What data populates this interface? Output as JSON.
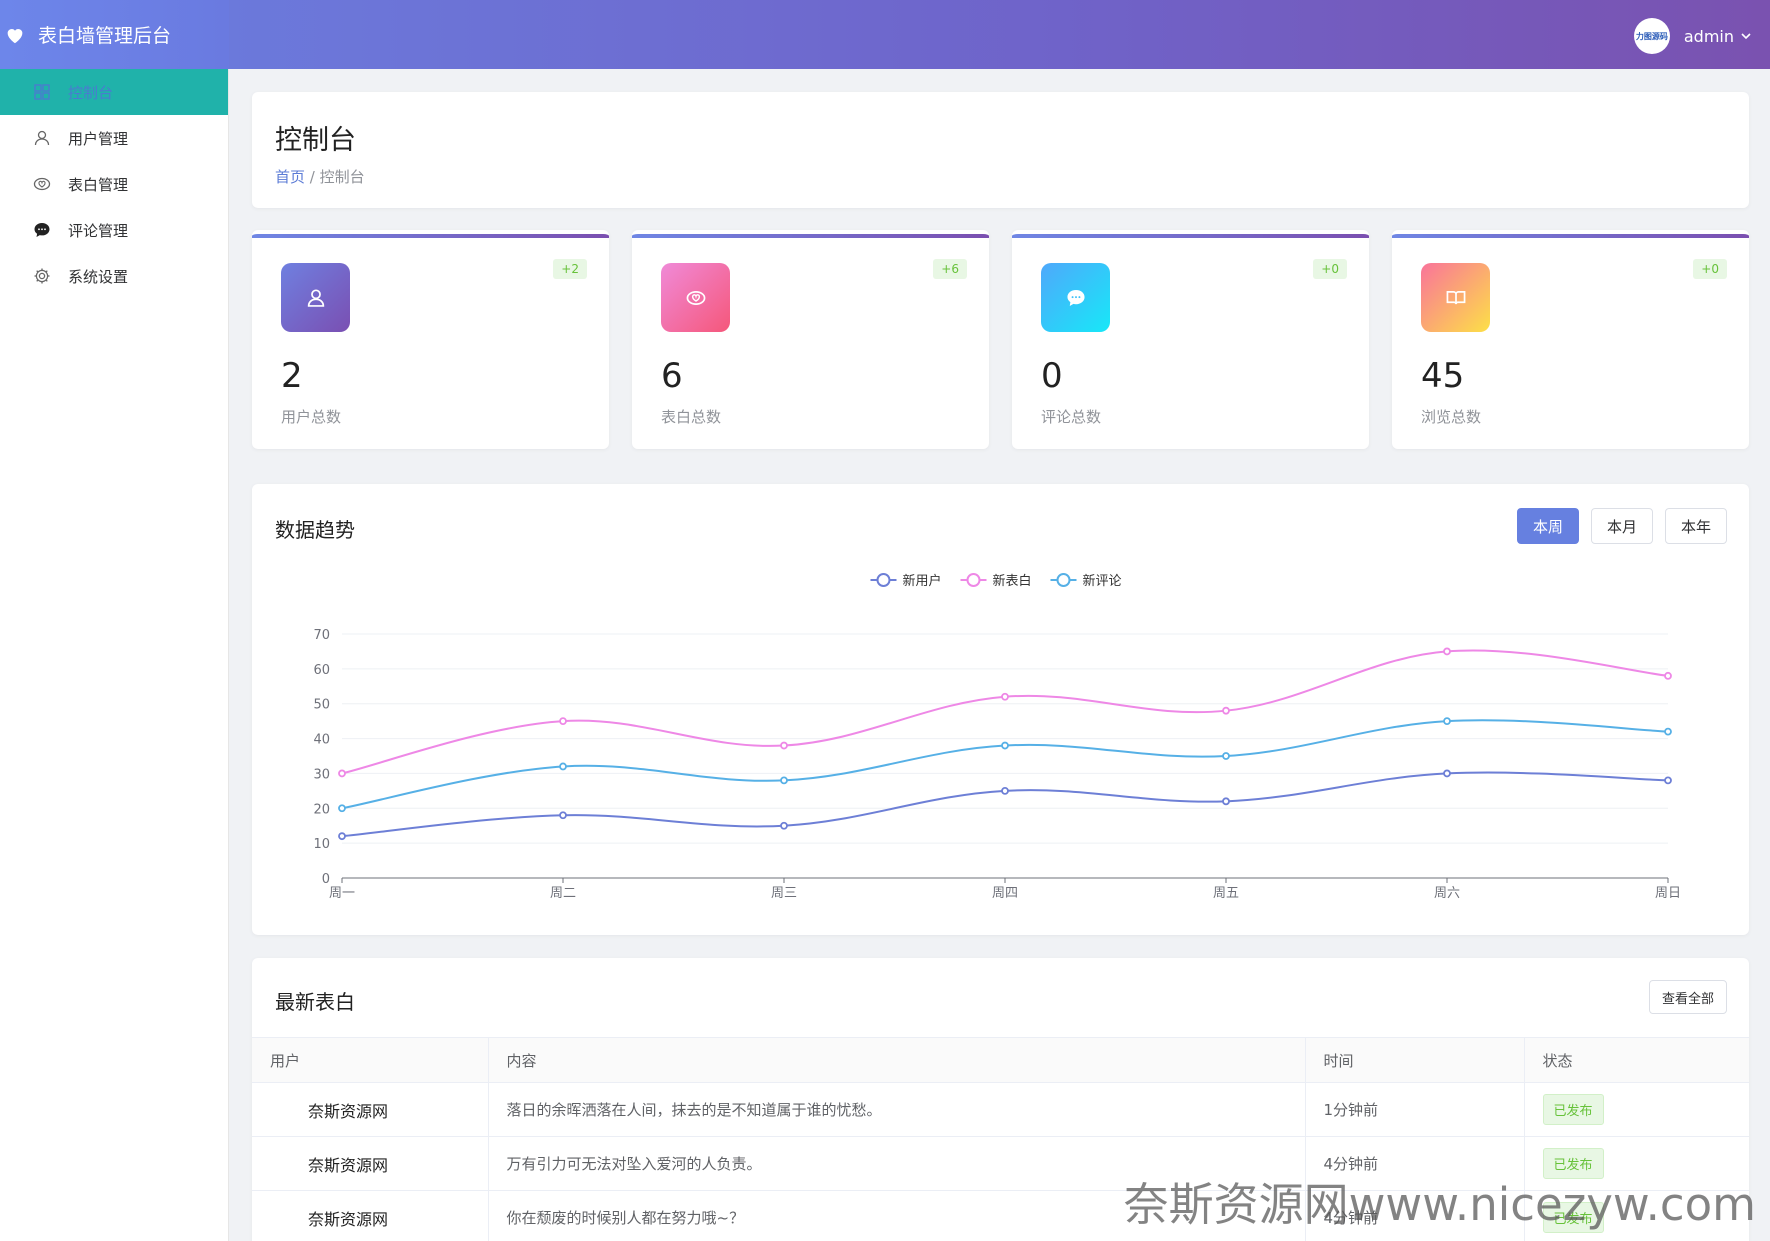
{
  "app": {
    "title": "表白墙管理后台",
    "user": "admin",
    "avatar_text": "力图源码"
  },
  "sidebar": {
    "items": [
      {
        "label": "控制台",
        "icon": "dashboard-icon"
      },
      {
        "label": "用户管理",
        "icon": "user-icon"
      },
      {
        "label": "表白管理",
        "icon": "love-icon"
      },
      {
        "label": "评论管理",
        "icon": "comment-icon"
      },
      {
        "label": "系统设置",
        "icon": "gear-icon"
      }
    ]
  },
  "page": {
    "title": "控制台",
    "breadcrumb_home": "首页",
    "breadcrumb_sep": " / ",
    "breadcrumb_current": "控制台"
  },
  "stats": [
    {
      "value": "2",
      "label": "用户总数",
      "badge": "+2",
      "icon": "user-icon",
      "color_from": "#6f80e0",
      "color_to": "#7a4fb2"
    },
    {
      "value": "6",
      "label": "表白总数",
      "badge": "+6",
      "icon": "love-icon",
      "color_from": "#f08ad8",
      "color_to": "#f5577a"
    },
    {
      "value": "0",
      "label": "评论总数",
      "badge": "+0",
      "icon": "comment-icon",
      "color_from": "#4fa8fb",
      "color_to": "#17e8f8"
    },
    {
      "value": "45",
      "label": "浏览总数",
      "badge": "+0",
      "icon": "book-icon",
      "color_from": "#f9739a",
      "color_to": "#fde047"
    }
  ],
  "trend": {
    "title": "数据趋势",
    "ranges": [
      "本周",
      "本月",
      "本年"
    ],
    "active_range": "本周"
  },
  "chart_data": {
    "type": "line",
    "categories": [
      "周一",
      "周二",
      "周三",
      "周四",
      "周五",
      "周六",
      "周日"
    ],
    "ylim": [
      0,
      70
    ],
    "yticks": [
      0,
      10,
      20,
      30,
      40,
      50,
      60,
      70
    ],
    "smooth": true,
    "grid": true,
    "legend_position": "top-center",
    "series": [
      {
        "name": "新用户",
        "color": "#6d7fd6",
        "values": [
          12,
          18,
          15,
          25,
          22,
          30,
          28
        ]
      },
      {
        "name": "新表白",
        "color": "#ee88e6",
        "values": [
          30,
          45,
          38,
          52,
          48,
          65,
          58
        ]
      },
      {
        "name": "新评论",
        "color": "#56b0e6",
        "values": [
          20,
          32,
          28,
          38,
          35,
          45,
          42
        ]
      }
    ]
  },
  "latest": {
    "title": "最新表白",
    "view_all": "查看全部",
    "columns": [
      "用户",
      "内容",
      "时间",
      "状态"
    ],
    "rows": [
      {
        "user": "奈斯资源网",
        "content": "落日的余晖洒落在人间，抹去的是不知道属于谁的忧愁。",
        "time": "1分钟前",
        "status": "已发布"
      },
      {
        "user": "奈斯资源网",
        "content": "万有引力可无法对坠入爱河的人负责。",
        "time": "4分钟前",
        "status": "已发布"
      },
      {
        "user": "奈斯资源网",
        "content": "你在颓废的时候别人都在努力哦~？",
        "time": "4分钟前",
        "status": "已发布"
      }
    ]
  },
  "watermark": "奈斯资源网www.nicezyw.com"
}
